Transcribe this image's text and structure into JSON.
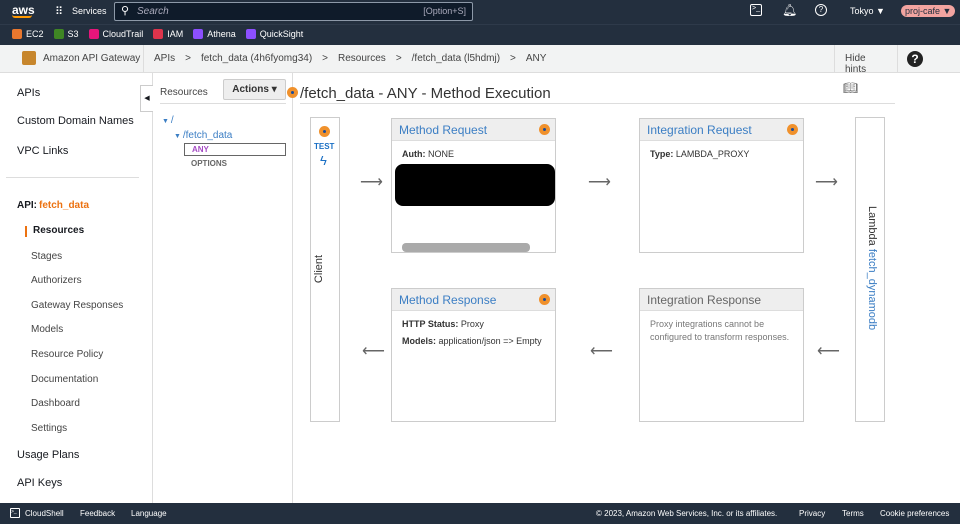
{
  "topnav": {
    "logo": "aws",
    "services": "Services",
    "search_placeholder": "Search",
    "search_shortcut": "[Option+S]",
    "region": "Tokyo ▼",
    "account": "proj-cafe ▼"
  },
  "favorites": [
    {
      "label": "EC2",
      "color": "#e8772e"
    },
    {
      "label": "S3",
      "color": "#3f8624"
    },
    {
      "label": "CloudTrail",
      "color": "#e7157b"
    },
    {
      "label": "IAM",
      "color": "#dd344c"
    },
    {
      "label": "Athena",
      "color": "#8c4fff"
    },
    {
      "label": "QuickSight",
      "color": "#8c4fff"
    }
  ],
  "breadcrumb": {
    "service": "Amazon API Gateway",
    "items": [
      "APIs",
      "fetch_data (4h6fyomg34)",
      "Resources",
      "/fetch_data (l5hdmj)",
      "ANY"
    ],
    "sep": ">",
    "hide_hints": "Hide hints"
  },
  "sidebar": {
    "top": [
      "APIs",
      "Custom Domain Names",
      "VPC Links"
    ],
    "api_label": "API:",
    "api_name": "fetch_data",
    "sub": [
      "Resources",
      "Stages",
      "Authorizers",
      "Gateway Responses",
      "Models",
      "Resource Policy",
      "Documentation",
      "Dashboard",
      "Settings"
    ],
    "bottom": [
      "Usage Plans",
      "API Keys"
    ]
  },
  "resources": {
    "title": "Resources",
    "actions": "Actions ▾",
    "tree": [
      "/",
      "/fetch_data",
      "ANY",
      "OPTIONS"
    ]
  },
  "main": {
    "title": "/fetch_data - ANY - Method Execution",
    "client": {
      "test": "TEST",
      "label": "Client"
    },
    "method_request": {
      "title": "Method Request",
      "auth_label": "Auth:",
      "auth_value": "NONE"
    },
    "integration_request": {
      "title": "Integration Request",
      "type_label": "Type:",
      "type_value": "LAMBDA_PROXY"
    },
    "method_response": {
      "title": "Method Response",
      "status_label": "HTTP Status:",
      "status_value": "Proxy",
      "models_label": "Models:",
      "models_value": "application/json => Empty"
    },
    "integration_response": {
      "title": "Integration Response",
      "note": "Proxy integrations cannot be configured to transform responses."
    },
    "lambda": {
      "label": "Lambda",
      "fn": "fetch_dynamodb"
    }
  },
  "footer": {
    "cloudshell": "CloudShell",
    "feedback": "Feedback",
    "language": "Language",
    "copyright": "© 2023, Amazon Web Services, Inc. or its affiliates.",
    "privacy": "Privacy",
    "terms": "Terms",
    "cookies": "Cookie preferences"
  }
}
